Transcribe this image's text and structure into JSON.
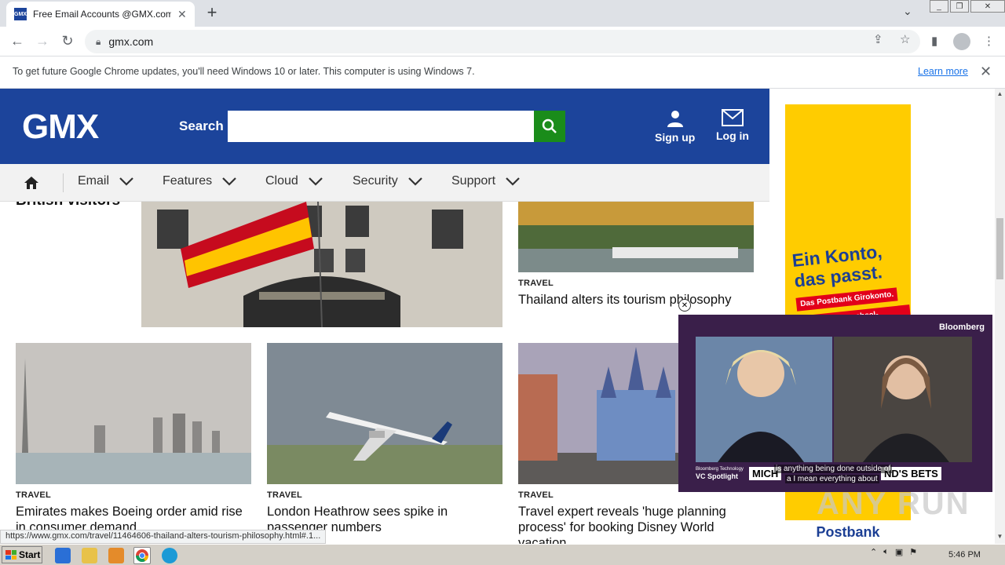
{
  "browser": {
    "tab_title": "Free Email Accounts @GMX.com: Se",
    "tab_favicon_text": "GMX",
    "new_tab": "+",
    "url": "gmx.com",
    "tab_close": "✕"
  },
  "infobar": {
    "message": "To get future Google Chrome updates, you'll need Windows 10 or later. This computer is using Windows 7.",
    "link": "Learn more",
    "close": "✕"
  },
  "header": {
    "logo": "GMX",
    "search_label": "Search",
    "search_value": "",
    "signup_label": "Sign up",
    "login_label": "Log in"
  },
  "nav": {
    "items": [
      "Email",
      "Features",
      "Cloud",
      "Security",
      "Support"
    ]
  },
  "articles": {
    "partial_title": "British visitors",
    "thailand": {
      "category": "TRAVEL",
      "headline": "Thailand alters its tourism philosophy"
    },
    "emirates": {
      "category": "TRAVEL",
      "headline": "Emirates makes Boeing order amid rise in consumer demand"
    },
    "heathrow": {
      "category": "TRAVEL",
      "headline": "London Heathrow sees spike in passenger numbers"
    },
    "disney": {
      "category": "TRAVEL",
      "headline": "Travel expert reveals 'huge planning process' for booking Disney World vacation"
    }
  },
  "ad": {
    "slogan_line1": "Ein Konto,",
    "slogan_line2": "das passt.",
    "tag1": "Das Postbank Girokonto.",
    "tag2": "Mit Kontowechsel-Service.",
    "brand": "Postbank"
  },
  "video": {
    "label": "Bloomberg",
    "caption1": "is anything being done outside of",
    "caption2": "a I mean everything about",
    "show_small": "Bloomberg Technology",
    "show": "VC Spotlight",
    "name_left": "MICH",
    "name_right": "ND'S BETS",
    "close": "✕"
  },
  "status_url": "https://www.gmx.com/travel/11464606-thailand-alters-tourism-philosophy.html#.1...",
  "watermark": "ANY RUN",
  "taskbar": {
    "start": "Start",
    "clock": "5:46 PM"
  },
  "colors": {
    "gmx_blue": "#1c449b",
    "search_green": "#1a8c1a",
    "ad_yellow": "#ffcc00",
    "postbank_red": "#e2001a"
  }
}
